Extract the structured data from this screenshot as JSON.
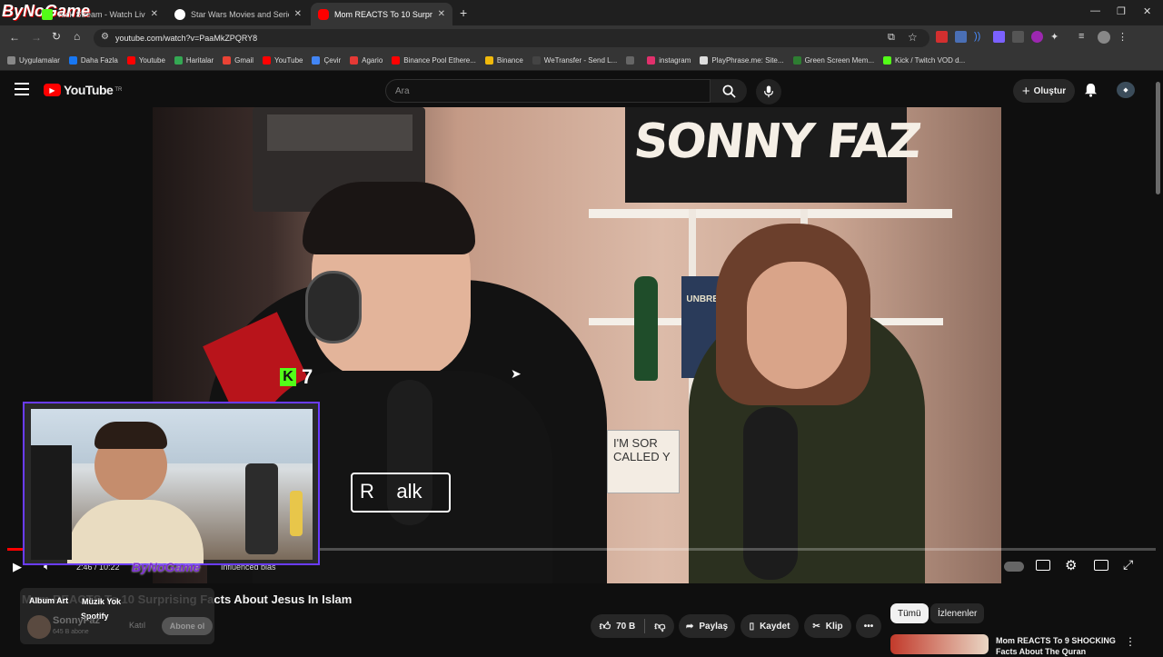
{
  "browser": {
    "tabs": [
      {
        "title": "Kick Stream - Watch Live",
        "color": "#53fc18"
      },
      {
        "title": "Star Wars Movies and Series Vi",
        "color": "#ffffff"
      },
      {
        "title": "Mom REACTS To 10 Surprising",
        "color": "#ff0000"
      }
    ],
    "watermark": "ByNoGame",
    "url": "youtube.com/watch?v=PaaMkZPQRY8",
    "bookmarks": [
      {
        "label": "Uygulamalar",
        "color": "#888"
      },
      {
        "label": "Daha Fazla",
        "color": "#1877f2"
      },
      {
        "label": "Youtube",
        "color": "#ff0000"
      },
      {
        "label": "Haritalar",
        "color": "#34a853"
      },
      {
        "label": "Gmail",
        "color": "#ea4335"
      },
      {
        "label": "YouTube",
        "color": "#ff0000"
      },
      {
        "label": "Çevir",
        "color": "#4285f4"
      },
      {
        "label": "Agario",
        "color": "#e53935"
      },
      {
        "label": "Binance Pool Ethere...",
        "color": "#ff0000"
      },
      {
        "label": "Binance",
        "color": "#f0b90b"
      },
      {
        "label": "WeTransfer - Send L...",
        "color": "#444"
      },
      {
        "label": "",
        "color": "#666"
      },
      {
        "label": "instagram",
        "color": "#e1306c"
      },
      {
        "label": "PlayPhrase.me: Site...",
        "color": "#ddd"
      },
      {
        "label": "Green Screen Mem...",
        "color": "#2e7d32"
      },
      {
        "label": "Kick / Twitch VOD d...",
        "color": "#53fc18"
      }
    ]
  },
  "youtube": {
    "logo": "YouTube",
    "logo_country": "TR",
    "search_placeholder": "Ara",
    "create_label": "Oluştur",
    "video_title": "Mom REACTS To 10 Surprising Facts About Jesus In Islam",
    "channel": "SonnyFaz",
    "subscribers": "645 B abone",
    "join_label": "Katıl",
    "subscribe_label": "Abone ol",
    "likes": "70 B",
    "share_label": "Paylaş",
    "save_label": "Kaydet",
    "clip_label": "Klip",
    "time": "2:46 / 10:22",
    "chapter": "Influenced bias",
    "progress_fraction": 0.02,
    "chips": [
      {
        "label": "Tümü"
      },
      {
        "label": "İzlenenler"
      }
    ],
    "up_next_title": "Mom REACTS To 9 SHOCKING Facts About The Quran"
  },
  "video": {
    "sign": "SONNY FAZ",
    "mic_sign": "R    alk",
    "kick_count": "7",
    "book_title": "UNBREAKABLE",
    "wall_sign": "I'M SOR CALLED Y"
  },
  "overlay": {
    "spotify_album": "Album Art",
    "spotify_status": "Müzik Yok",
    "spotify_app": "Spotify",
    "nameplate": "ByNoGame"
  }
}
